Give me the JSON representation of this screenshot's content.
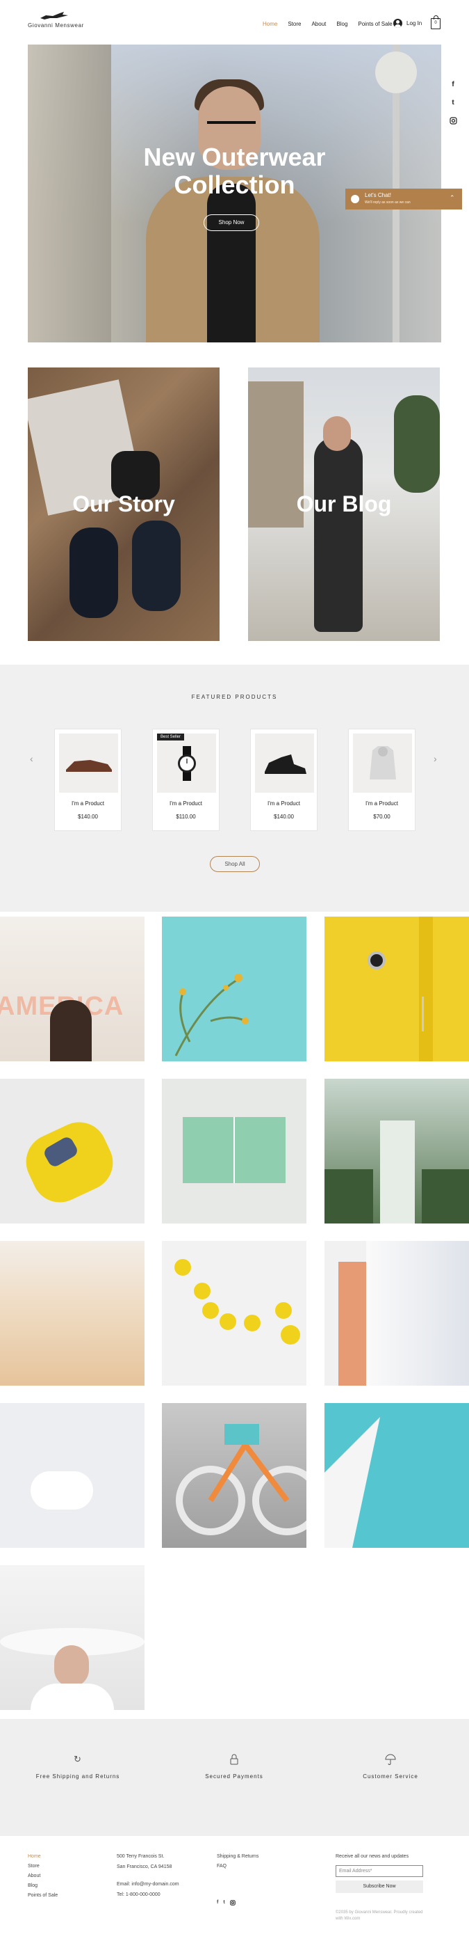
{
  "header": {
    "brand": "Giovanni Menswear",
    "nav": [
      "Home",
      "Store",
      "About",
      "Blog",
      "Points of Sale"
    ],
    "login": "Log In",
    "cart_count": "0"
  },
  "social": [
    "f",
    "t",
    "ig"
  ],
  "hero": {
    "title_line1": "New Outerwear",
    "title_line2": "Collection",
    "button": "Shop Now"
  },
  "chat": {
    "title": "Let's Chat!",
    "subtitle": "We'll reply as soon as we can"
  },
  "cards": {
    "story": "Our Story",
    "blog": "Our Blog"
  },
  "featured": {
    "title": "FEATURED PRODUCTS",
    "products": [
      {
        "name": "I'm a Product",
        "price": "$140.00",
        "badge": ""
      },
      {
        "name": "I'm a Product",
        "price": "$110.00",
        "badge": "Best Seller"
      },
      {
        "name": "I'm a Product",
        "price": "$140.00",
        "badge": ""
      },
      {
        "name": "I'm a Product",
        "price": "$70.00",
        "badge": ""
      }
    ],
    "shop_all": "Shop All"
  },
  "gallery_text": "AMERICA",
  "features": [
    {
      "label": "Free Shipping and Returns",
      "icon": "refresh-icon"
    },
    {
      "label": "Secured Payments",
      "icon": "lock-icon"
    },
    {
      "label": "Customer Service",
      "icon": "umbrella-icon"
    }
  ],
  "footer": {
    "nav": [
      "Home",
      "Store",
      "About",
      "Blog",
      "Points of Sale"
    ],
    "address1": "500 Terry Francois St.",
    "address2": "San Francisco, CA 94158",
    "email": "Email: info@my-domain.com",
    "tel": "Tel: 1-800-000-0000",
    "links": [
      "Shipping & Returns",
      "FAQ"
    ],
    "subscribe_label": "Receive all our news and updates",
    "email_placeholder": "Email Address*",
    "subscribe_button": "Subscribe Now",
    "copyright": "©2035 by Giovanni Menswear. Proudly created with Wix.com"
  },
  "colors": {
    "accent": "#c68a4e",
    "chat": "#b2804a"
  }
}
